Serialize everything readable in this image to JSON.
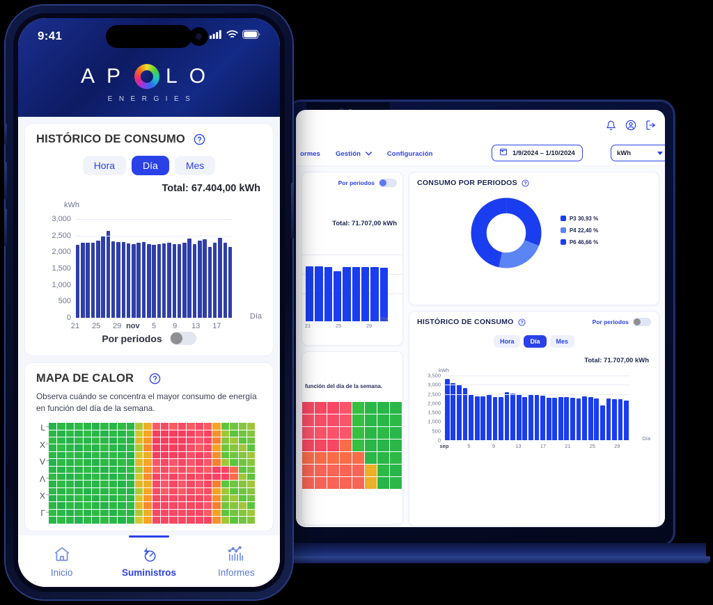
{
  "colors": {
    "brand_blue": "#2b41e8",
    "bar_blue_phone": "#2f3fa8",
    "bar_blue_laptop": "#1b3df0",
    "donut_dark": "#1b3df0",
    "donut_light": "#5b84f5"
  },
  "phone": {
    "status": {
      "time": "9:41",
      "signal_icon": "cellular-signal-icon",
      "wifi_icon": "wifi-icon",
      "battery_icon": "battery-icon"
    },
    "logo": {
      "word": "APOLO",
      "letters": [
        "A",
        "P",
        "L",
        "O"
      ],
      "tagline": "ENERGIES",
      "mark": "apolo-ring-icon"
    },
    "history_card": {
      "title": "HISTÓRICO DE CONSUMO",
      "help_icon": "help-circle-icon",
      "segments": [
        "Hora",
        "Día",
        "Mes"
      ],
      "active_segment": "Día",
      "total": "Total: 67.404,00 kWh",
      "toggle_label": "Por periodos",
      "toggle_state": "off"
    },
    "heat_card": {
      "title": "MAPA DE CALOR",
      "help_icon": "help-circle-icon",
      "description": "Observa cuándo se concentra el mayor consumo de energía en función del día de la semana.",
      "row_labels": [
        "L",
        "X",
        "V",
        "Λ",
        "X",
        "Γ"
      ]
    },
    "nav": [
      {
        "label": "Inicio",
        "icon": "home-icon",
        "active": false
      },
      {
        "label": "Suministros",
        "icon": "energy-gauge-icon",
        "active": true
      },
      {
        "label": "Informes",
        "icon": "reports-chart-icon",
        "active": false
      }
    ]
  },
  "laptop": {
    "topbar": {
      "bell_icon": "bell-icon",
      "account_icon": "user-circle-icon",
      "logout_icon": "logout-icon"
    },
    "nav": {
      "items": [
        "ormes",
        "Gestión",
        "Configuración"
      ],
      "dropdown_icon": "chevron-down-icon",
      "date_range": "1/9/2024 – 1/10/2024",
      "calendar_icon": "calendar-icon",
      "unit": "kWh",
      "unit_caret_icon": "caret-down-icon"
    },
    "left_history_card": {
      "toggle_label": "Por periodos",
      "toggle_state": "on",
      "total": "Total: 71.707,00 kWh"
    },
    "left_heat_card": {
      "description_fragment": "función del día de la semana."
    },
    "periods_card": {
      "title": "CONSUMO POR PERIODOS",
      "help_icon": "help-circle-icon"
    },
    "history_card": {
      "title": "HISTÓRICO DE CONSUMO",
      "help_icon": "help-circle-icon",
      "toggle_label": "Por periodos",
      "toggle_state": "off",
      "segments": [
        "Hora",
        "Día",
        "Mes"
      ],
      "active_segment": "Día",
      "total": "Total: 71.707,00 kWh"
    }
  },
  "chart_data": [
    {
      "id": "phone-history-bar",
      "type": "bar",
      "title": "HISTÓRICO DE CONSUMO",
      "xlabel": "Día",
      "ylabel": "kWh",
      "ylim": [
        0,
        3000
      ],
      "yticks": [
        0,
        500,
        1000,
        1500,
        2000,
        2500,
        3000
      ],
      "ytick_labels": [
        "0",
        "500",
        "1,000",
        "1,500",
        "2,000",
        "2,500",
        "3,000"
      ],
      "xtick_labels": [
        "21",
        "25",
        "29",
        "nov",
        "5",
        "9",
        "13",
        "17"
      ],
      "xtick_positions": [
        0,
        4,
        8,
        11,
        15,
        19,
        23,
        27
      ],
      "grid": true,
      "total_label": "Total: 67.404,00 kWh",
      "color": "#2f3fa8",
      "values": [
        2210,
        2290,
        2280,
        2275,
        2350,
        2475,
        2640,
        2315,
        2310,
        2300,
        2260,
        2230,
        2290,
        2300,
        2235,
        2225,
        2250,
        2270,
        2285,
        2245,
        2250,
        2290,
        2400,
        2250,
        2340,
        2380,
        2145,
        2285,
        2420,
        2290,
        2160
      ]
    },
    {
      "id": "laptop-history-bar",
      "type": "bar",
      "title": "HISTÓRICO DE CONSUMO",
      "xlabel": "Día",
      "ylabel": "kWh",
      "ylim": [
        0,
        3500
      ],
      "yticks": [
        0,
        500,
        1000,
        1500,
        2000,
        2500,
        3000,
        3500
      ],
      "ytick_labels": [
        "0",
        "500",
        "1,000",
        "1,500",
        "2,000",
        "2,500",
        "3,000",
        "3,500"
      ],
      "xtick_labels": [
        "sep",
        "5",
        "9",
        "13",
        "17",
        "21",
        "25",
        "29"
      ],
      "xtick_positions": [
        0,
        4,
        8,
        12,
        16,
        20,
        24,
        28
      ],
      "grid": true,
      "total_label": "Total: 71.707,00 kWh",
      "color": "#1b3df0",
      "values": [
        3300,
        3070,
        3010,
        2840,
        2430,
        2360,
        2380,
        2450,
        2320,
        2340,
        2600,
        2520,
        2480,
        2330,
        2430,
        2430,
        2420,
        2290,
        2290,
        2330,
        2350,
        2290,
        2250,
        2370,
        2330,
        2270,
        1870,
        2270,
        2230,
        2220,
        2160
      ]
    },
    {
      "id": "laptop-left-history-bar",
      "type": "bar",
      "xlabel": "Día",
      "ylim": [
        0,
        3500
      ],
      "xtick_labels": [
        "21",
        "25",
        "29"
      ],
      "total_label": "Total: 71.707,00 kWh",
      "color": "#1b3df0",
      "values": [
        2330,
        2330,
        2310,
        2130,
        2320,
        2320,
        2320,
        2300,
        2290
      ]
    },
    {
      "id": "laptop-periods-donut",
      "type": "pie",
      "title": "CONSUMO POR PERIODOS",
      "legend_position": "right",
      "labels": [
        "P3",
        "P4",
        "P6"
      ],
      "values": [
        30.93,
        22.4,
        46.66
      ],
      "value_labels": [
        "P3 30,93 %",
        "P4 22,40 %",
        "P6 46,66 %"
      ],
      "colors": [
        "#1b3df0",
        "#5b84f5",
        "#1b3df0"
      ]
    },
    {
      "id": "phone-heatmap",
      "type": "heatmap",
      "title": "MAPA DE CALOR",
      "description": "Observa cuándo se concentra el mayor consumo de energía en función del día de la semana.",
      "row_labels": [
        "L",
        "X",
        "V",
        "Λ",
        "X",
        "Γ"
      ],
      "rows": 14,
      "cols": 24,
      "palette": [
        "#22b14c",
        "#3ec43e",
        "#8ac63e",
        "#d4c72e",
        "#f5a623",
        "#f77b34",
        "#f9556b",
        "#f53d5e"
      ]
    },
    {
      "id": "laptop-heatmap",
      "type": "heatmap",
      "rows": 7,
      "cols": 8,
      "palette": [
        "#22b14c",
        "#3ec43e",
        "#8ac63e",
        "#f5a623",
        "#f77b34",
        "#f9556b",
        "#f53d5e"
      ]
    }
  ]
}
